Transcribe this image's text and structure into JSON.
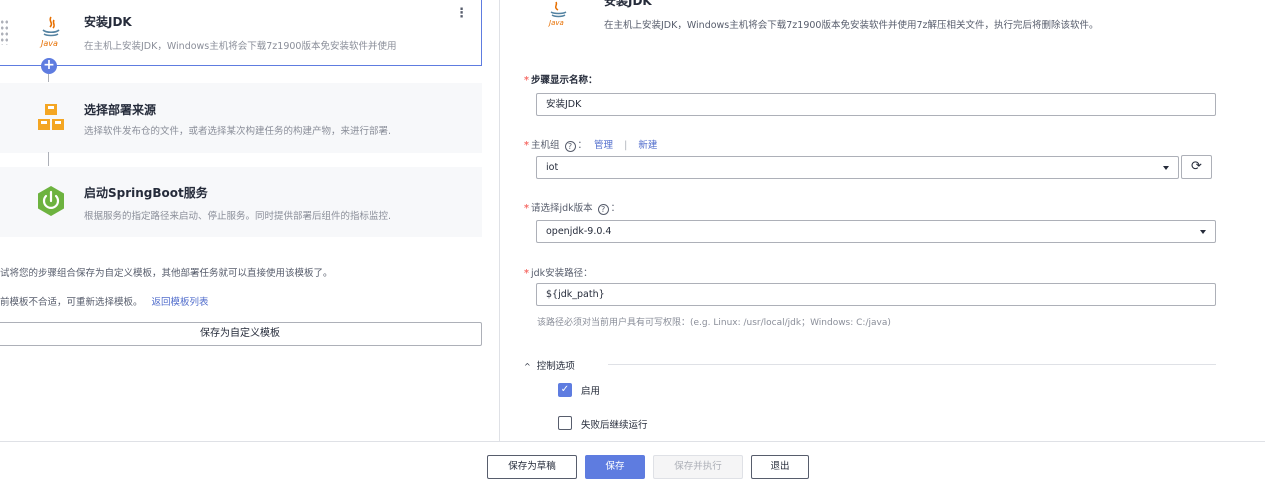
{
  "steps": [
    {
      "title": "安装JDK",
      "desc": "在主机上安装JDK，Windows主机将会下载7z1900版本免安装软件并使用",
      "icon": "java-icon",
      "active": true
    },
    {
      "title": "选择部署来源",
      "desc": "选择软件发布仓的文件，或者选择某次构建任务的构建产物，来进行部署.",
      "icon": "source-boxes-icon"
    },
    {
      "title": "启动SpringBoot服务",
      "desc": "根据服务的指定路径来启动、停止服务。同时提供部署后组件的指标监控.",
      "icon": "springboot-power-icon"
    }
  ],
  "template": {
    "save_hint": "试将您的步骤组合保存为自定义模板，其他部署任务就可以直接使用该模板了。",
    "reselect_hint": "前模板不合适，可重新选择模板。",
    "back_link": "返回模板列表",
    "save_button": "保存为自定义模板"
  },
  "detail": {
    "title_partial": "安装JDK",
    "desc": "在主机上安装JDK，Windows主机将会下载7z1900版本免安装软件并使用7z解压相关文件，执行完后将删除该软件。",
    "step_name_label": "步骤显示名称：",
    "step_name_value": "安装JDK",
    "host_group_label": "主机组",
    "manage_link": "管理",
    "separator": "|",
    "new_link": "新建",
    "host_group_value": "iot",
    "jdk_version_label": "请选择jdk版本",
    "jdk_version_value": "openjdk-9.0.4",
    "jdk_path_label": "jdk安装路径：",
    "jdk_path_value": "${jdk_path}",
    "jdk_path_hint": "该路径必须对当前用户具有可写权限：(e.g. Linux: /usr/local/jdk；Windows: C:/java)",
    "control_label": "控制选项",
    "enable_label": "启用",
    "enable_checked": true,
    "continue_label": "失败后继续运行",
    "continue_checked": false
  },
  "footer": {
    "draft": "保存为草稿",
    "save": "保存",
    "save_run": "保存并执行",
    "exit": "退出"
  },
  "colors": {
    "primary": "#5e7ce0",
    "required": "#f66f6a",
    "link": "#526ecc"
  }
}
